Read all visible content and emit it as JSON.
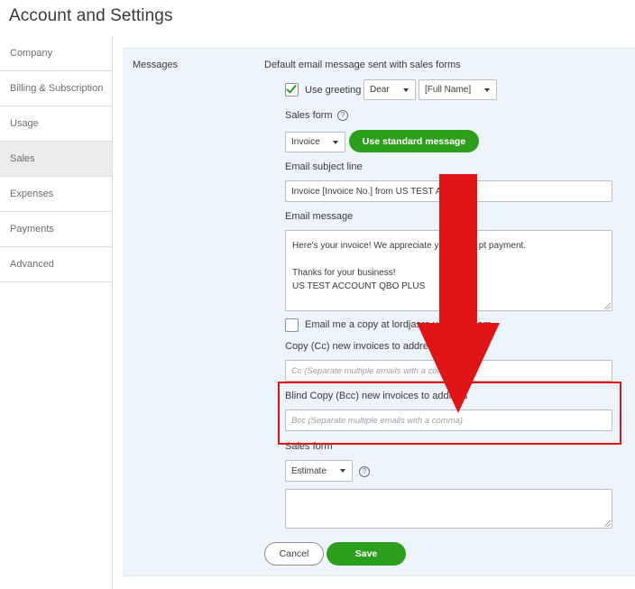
{
  "page": {
    "title": "Account and Settings"
  },
  "sidebar": {
    "items": [
      {
        "label": "Company",
        "active": false
      },
      {
        "label": "Billing & Subscription",
        "active": false
      },
      {
        "label": "Usage",
        "active": false
      },
      {
        "label": "Sales",
        "active": true
      },
      {
        "label": "Expenses",
        "active": false
      },
      {
        "label": "Payments",
        "active": false
      },
      {
        "label": "Advanced",
        "active": false
      }
    ]
  },
  "messages": {
    "section_label": "Messages",
    "description": "Default email message sent with sales forms",
    "use_greeting": {
      "label": "Use greeting",
      "checked": true
    },
    "greeting_select": "Dear",
    "name_select": "[Full Name]",
    "sales_form_label": "Sales form",
    "sales_form_select": "Invoice",
    "use_standard_button": "Use standard message",
    "subject_label": "Email subject line",
    "subject_value": "Invoice [Invoice No.] from US TEST A",
    "email_message_label": "Email message",
    "email_message_value": "Here's your invoice! We appreciate y                pt payment.\n\nThanks for your business!\nUS TEST ACCOUNT QBO PLUS",
    "email_me_copy": {
      "label": "Email me a copy at lordjasre.v                   centrix.com",
      "checked": false
    },
    "cc_label": "Copy (Cc) new invoices to address",
    "cc_placeholder": "Cc (Separate multiple emails with a comma)",
    "bcc_label": "Blind Copy (Bcc) new invoices to address",
    "bcc_placeholder": "Bcc (Separate multiple emails with a comma)",
    "sales_form2_label": "Sales form",
    "sales_form2_select": "Estimate",
    "estimate_message_value": "",
    "cancel_button": "Cancel",
    "save_button": "Save"
  },
  "colors": {
    "accent_green": "#2ca01c",
    "annotation_red": "#e01414",
    "panel_bg": "#eef4fb"
  }
}
